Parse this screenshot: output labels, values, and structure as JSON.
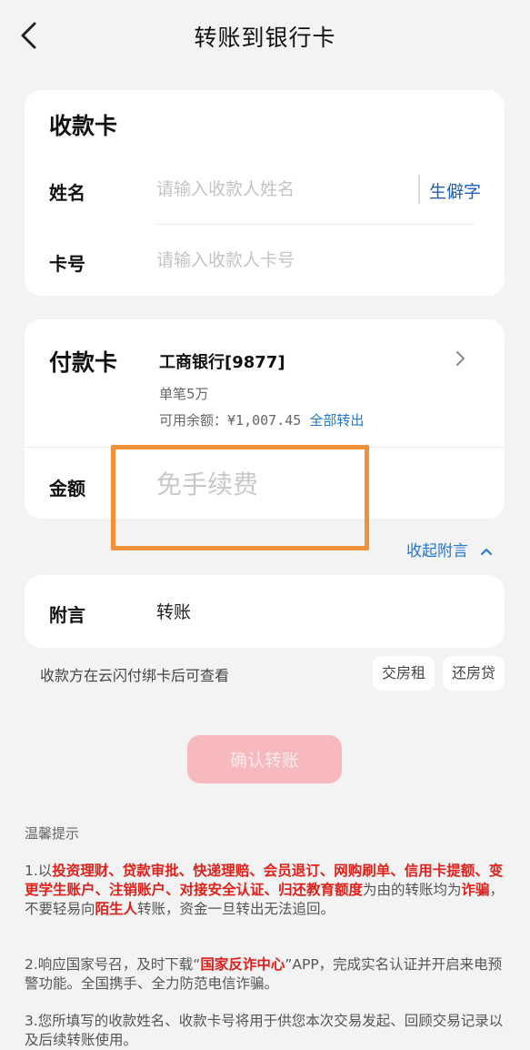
{
  "header": {
    "title": "转账到银行卡",
    "back_icon": "chevron-left-icon"
  },
  "payee": {
    "section_title": "收款卡",
    "name_label": "姓名",
    "name_placeholder": "请输入收款人姓名",
    "name_value": "",
    "rare_char_label": "生僻字",
    "card_label": "卡号",
    "card_placeholder": "请输入收款人卡号",
    "card_value": ""
  },
  "payer": {
    "section_title": "付款卡",
    "bank_name": "工商银行[9877]",
    "limit": "单笔5万",
    "balance_label": "可用余额：",
    "balance_value": "¥1,007.45",
    "transfer_all_label": "全部转出",
    "amount_label": "金额",
    "amount_placeholder": "免手续费",
    "amount_value": ""
  },
  "note": {
    "toggle_label": "收起附言",
    "label": "附言",
    "value": "转账",
    "hint": "收款方在云闪付绑卡后可查看",
    "chips": [
      "交房租",
      "还房贷"
    ]
  },
  "confirm_label": "确认转账",
  "tips": {
    "title": "温馨提示",
    "tip1": {
      "prefix": "1.以",
      "red1": "投资理财、贷款审批、快递理赔、会员退订、网购刷单、信用卡提额、变更学生账户、注销账户、对接安全认证、归还教育额度",
      "mid1": "为由的转账均为",
      "red2": "诈骗",
      "mid2": "，不要轻易向",
      "red3": "陌生人",
      "suffix": "转账，资金一旦转出无法追回。"
    },
    "tip2": {
      "prefix": "2.响应国家号召，及时下载“",
      "red": "国家反诈中心",
      "suffix": "”APP，完成实名认证并开启来电预警功能。全国携手、全力防范电信诈骗。"
    },
    "tip3": "3.您所填写的收款姓名、收款卡号将用于供您本次交易发起、回顾交易记录以及后续转账使用。"
  },
  "colors": {
    "accent_blue": "#1f78d1",
    "warning_red": "#e0201a",
    "confirm_disabled": "#f7b9be",
    "highlight_orange": "#f0923a"
  }
}
